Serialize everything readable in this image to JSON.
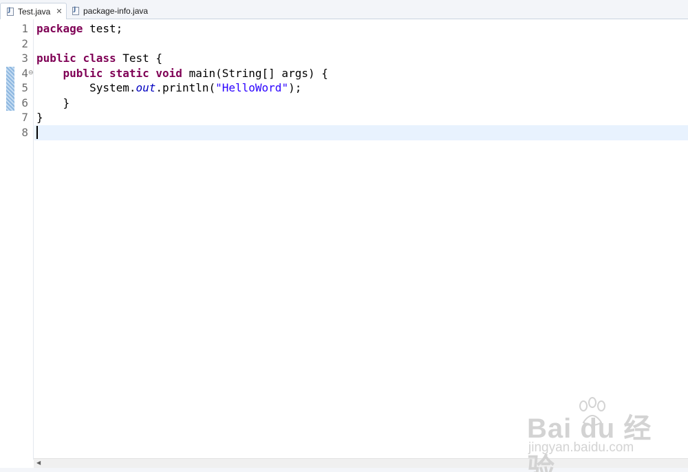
{
  "tabs": [
    {
      "label": "Test.java",
      "active": true
    },
    {
      "label": "package-info.java",
      "active": false
    }
  ],
  "editor": {
    "line_numbers": [
      "1",
      "2",
      "3",
      "4",
      "5",
      "6",
      "7",
      "8"
    ],
    "lines": {
      "l1_kw": "package",
      "l1_rest": " test;",
      "l3_kw1": "public",
      "l3_kw2": "class",
      "l3_rest": " Test {",
      "l4_indent": "    ",
      "l4_kw1": "public",
      "l4_kw2": "static",
      "l4_kw3": "void",
      "l4_rest": " main(String[] args) {",
      "l5_pre": "        System.",
      "l5_field": "out",
      "l5_mid": ".println(",
      "l5_str": "\"HelloWord\"",
      "l5_end": ");",
      "l6": "    }",
      "l7": "}"
    },
    "fold_line": 4,
    "current_line": 8
  },
  "watermark": {
    "brand": "Bai du 经验",
    "url": "jingyan.baidu.com"
  },
  "colors": {
    "keyword": "#7f0055",
    "string": "#2a00ff",
    "field": "#0000c0",
    "current_line": "#e8f2fe"
  }
}
